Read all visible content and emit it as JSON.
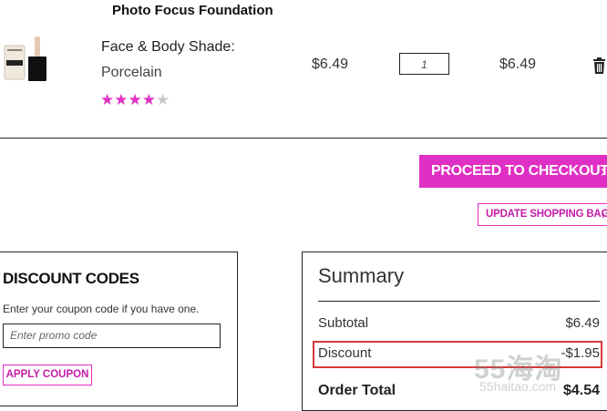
{
  "product": {
    "name": "Photo Focus Foundation",
    "shade_label": "Face & Body Shade:",
    "shade_value": "Porcelain",
    "rating": 4,
    "rating_max": 5,
    "price": "$6.49",
    "quantity": "1",
    "subtotal": "$6.49"
  },
  "actions": {
    "checkout_label": "PROCEED TO CHECKOUT",
    "update_label": "UPDATE SHOPPING BAG"
  },
  "discount_codes": {
    "title": "DISCOUNT CODES",
    "hint": "Enter your coupon code if you have one.",
    "placeholder": "Enter promo code",
    "apply_label": "APPLY COUPON"
  },
  "summary": {
    "title": "Summary",
    "subtotal_label": "Subtotal",
    "subtotal_value": "$6.49",
    "discount_label": "Discount",
    "discount_value": "-$1.95",
    "total_label": "Order Total",
    "total_value": "$4.54"
  },
  "watermark": {
    "big": "55海淘",
    "small": "55haitao.com"
  },
  "colors": {
    "accent": "#e02fc4",
    "highlight_border": "#d83a3a"
  }
}
